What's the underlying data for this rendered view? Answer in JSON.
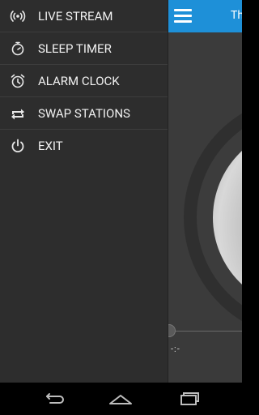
{
  "menu": {
    "items": [
      {
        "label": "LIVE STREAM",
        "icon": "live-stream-icon"
      },
      {
        "label": "SLEEP TIMER",
        "icon": "sleep-timer-icon"
      },
      {
        "label": "ALARM CLOCK",
        "icon": "alarm-clock-icon"
      },
      {
        "label": "SWAP STATIONS",
        "icon": "swap-stations-icon"
      },
      {
        "label": "EXIT",
        "icon": "power-icon"
      }
    ]
  },
  "main": {
    "title_partial": "Th",
    "time": "-:-"
  },
  "colors": {
    "header_blue": "#1e90d8",
    "drawer_bg": "#2d2d2d",
    "text": "#f2f2f2"
  },
  "navbar": {
    "buttons": [
      "back-icon",
      "home-icon",
      "recent-apps-icon"
    ]
  }
}
